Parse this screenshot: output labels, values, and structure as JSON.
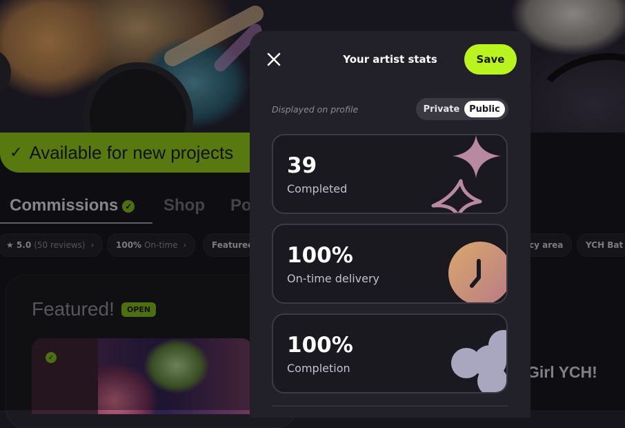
{
  "background": {
    "availability_text": "Available for new projects",
    "tabs": [
      {
        "label": "Commissions"
      },
      {
        "label": "Shop"
      },
      {
        "label": "Po"
      }
    ],
    "chips": [
      {
        "main": "★ 5.0",
        "sub": "(50 reviews)",
        "suffix": "›"
      },
      {
        "main": "100%",
        "sub": "On-time",
        "suffix": "›"
      },
      {
        "main": "Featured",
        "sub": "",
        "suffix": ""
      },
      {
        "main": "cy area",
        "sub": "",
        "suffix": ""
      },
      {
        "main": "YCH Bat",
        "sub": "",
        "suffix": ""
      }
    ],
    "featured_title": "Featured!",
    "open_badge": "OPEN",
    "listing_title": "Girl YCH!"
  },
  "modal": {
    "title": "Your artist stats",
    "save_label": "Save",
    "displayed_label": "Displayed on profile",
    "toggle": {
      "options": [
        "Private",
        "Public"
      ],
      "selected": "Public"
    },
    "stats": [
      {
        "value": "39",
        "label": "Completed",
        "icon": "sparkle-stars-icon"
      },
      {
        "value": "100%",
        "label": "On-time delivery",
        "icon": "clock-icon"
      },
      {
        "value": "100%",
        "label": "Completion",
        "icon": "flower-icon"
      }
    ]
  },
  "colors": {
    "accent": "#b9f320",
    "availability_green": "#8fc41a",
    "modal_bg": "#22212a",
    "card_bg": "#1a1920"
  }
}
